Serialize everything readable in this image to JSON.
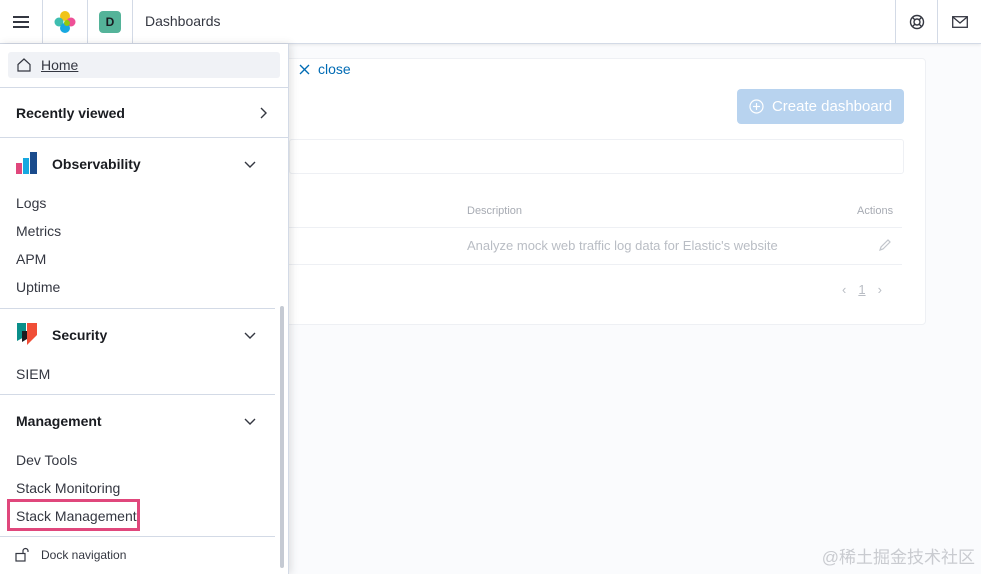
{
  "header": {
    "breadcrumb": "Dashboards",
    "space_initial": "D",
    "icons": [
      "menu-icon",
      "elastic-logo",
      "help-icon",
      "mail-icon"
    ]
  },
  "background_page": {
    "close_label": "close",
    "create_button_label": "Create dashboard",
    "table": {
      "columns": [
        "Description",
        "Actions"
      ],
      "rows": [
        {
          "description": "Analyze mock web traffic log data for Elastic's website"
        }
      ]
    },
    "pagination": {
      "current_page": "1"
    }
  },
  "nav": {
    "home_label": "Home",
    "recently_viewed_label": "Recently viewed",
    "sections": [
      {
        "title": "Observability",
        "items": [
          "Logs",
          "Metrics",
          "APM",
          "Uptime"
        ]
      },
      {
        "title": "Security",
        "items": [
          "SIEM"
        ]
      },
      {
        "title": "Management",
        "items": [
          "Dev Tools",
          "Stack Monitoring",
          "Stack Management"
        ]
      }
    ],
    "dock_label": "Dock navigation",
    "highlighted_item": "Stack Management"
  },
  "colors": {
    "accent": "#006bb4",
    "highlight_border": "#e0477c",
    "space_avatar": "#54b399"
  },
  "watermark": "@稀土掘金技术社区"
}
